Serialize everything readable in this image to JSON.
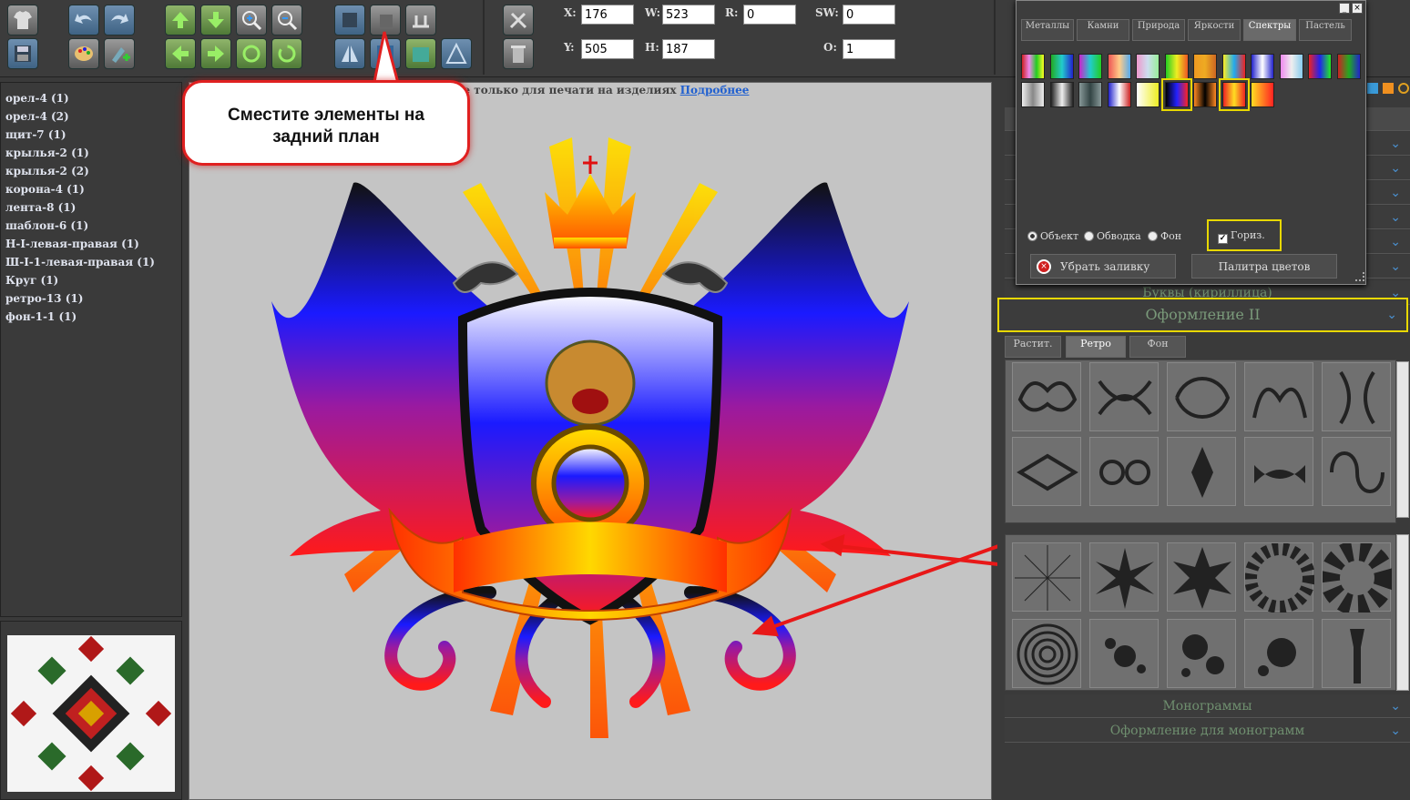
{
  "toolbar": {
    "coords": {
      "x_label": "X:",
      "x": "176",
      "y_label": "Y:",
      "y": "505",
      "w_label": "W:",
      "w": "523",
      "h_label": "H:",
      "h": "187",
      "r_label": "R:",
      "r": "0",
      "sw_label": "SW:",
      "sw": "0",
      "o_label": "O:",
      "o": "1"
    },
    "icons": [
      "tshirt-icon",
      "save-icon",
      "undo-icon",
      "redo-icon",
      "palette-icon",
      "add-image-icon",
      "move-up-icon",
      "move-down-icon",
      "zoom-in-icon",
      "zoom-out-icon",
      "move-left-icon",
      "move-right-icon",
      "rotate-left-icon",
      "rotate-right-icon",
      "bring-front-icon",
      "send-back-icon",
      "align-icon",
      "flip-horizontal-icon",
      "flip-vertical-icon",
      "tools-icon",
      "trash-icon"
    ]
  },
  "layers": [
    "орел-4 (1)",
    "орел-4 (2)",
    "щит-7 (1)",
    "крылья-2 (1)",
    "крылья-2 (2)",
    "корона-4 (1)",
    "лента-8 (1)",
    "шаблон-6 (1)",
    "Н-I-левая-правая (1)",
    "Ш-I-1-левая-правая (1)",
    "Круг (1)",
    "ретро-13 (1)",
    "фон-1-1 (1)"
  ],
  "notice": {
    "text": "ле только для печати на изделиях",
    "link": "Подробнее"
  },
  "callout": {
    "line1": "Сместите элементы на",
    "line2": "задний план"
  },
  "palette": {
    "tabs": [
      "Металлы",
      "Камни",
      "Природа",
      "Яркости",
      "Спектры",
      "Пастель"
    ],
    "active_tab": "Спектры",
    "radios": [
      "Объект",
      "Обводка",
      "Фон"
    ],
    "horiz_label": "Гориз.",
    "remove_fill": "Убрать заливку",
    "color_palette": "Палитра цветов"
  },
  "accordions": {
    "letters": "Буквы (кириллица)",
    "decor2": "Оформление II",
    "monograms": "Монограммы",
    "mono_decor": "Оформление для монограмм"
  },
  "subtabs": [
    "Растит.",
    "Ретро",
    "Фон"
  ],
  "active_subtab": "Ретро",
  "colors": {
    "accent_yellow": "#e8d800",
    "callout_red": "#e02020",
    "link": "#2060d0"
  }
}
